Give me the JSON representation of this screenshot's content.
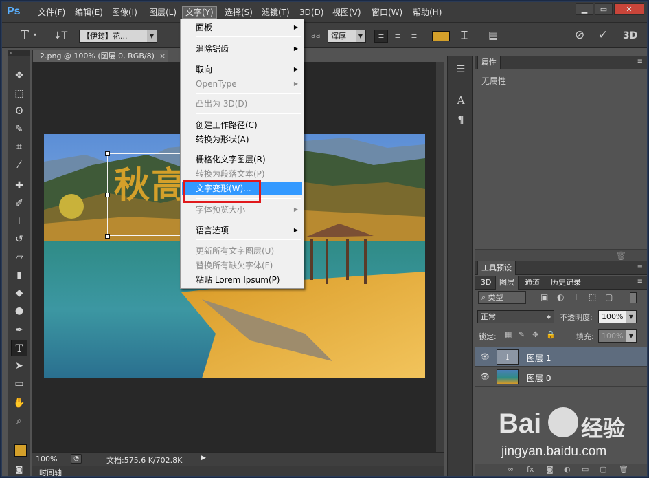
{
  "app": {
    "logo": "Ps"
  },
  "menubar": {
    "items": [
      "文件(F)",
      "编辑(E)",
      "图像(I)",
      "图层(L)",
      "文字(Y)",
      "选择(S)",
      "滤镜(T)",
      "3D(D)",
      "视图(V)",
      "窗口(W)",
      "帮助(H)"
    ],
    "active_index": 4
  },
  "window_controls": {
    "minimize": "▁",
    "restore": "▭",
    "close": "✕"
  },
  "options_bar": {
    "tool_icon": "T",
    "font_family": "【伊筠】花...",
    "antialias": "浑厚",
    "aa_label": "aa",
    "three_d": "3D"
  },
  "document_tab": {
    "title": "2.png @ 100% (图层 0, RGB/8)",
    "close": "×"
  },
  "canvas_text": {
    "value": "秋高"
  },
  "status": {
    "zoom": "100%",
    "doc_info": "文档:575.6 K/702.8K"
  },
  "timeline": {
    "label": "时间轴"
  },
  "properties": {
    "title": "属性",
    "empty_text": "无属性"
  },
  "presets": {
    "title": "工具预设"
  },
  "layers_panel": {
    "tabs": [
      "3D",
      "图层",
      "通道",
      "历史记录"
    ],
    "active_tab": 1,
    "filter_kind": "类型",
    "blend_mode": "正常",
    "opacity_label": "不透明度:",
    "opacity_value": "100%",
    "lock_label": "锁定:",
    "fill_label": "填充:",
    "fill_value": "100%",
    "layers": [
      {
        "name": "图层 1",
        "thumb": "T",
        "selected": true
      },
      {
        "name": "图层 0",
        "thumb": "",
        "selected": false
      }
    ]
  },
  "dropdown": {
    "items": [
      {
        "label": "面板",
        "submenu": true,
        "disabled": false
      },
      {
        "label": "消除锯齿",
        "submenu": true,
        "disabled": false
      },
      {
        "label": "取向",
        "submenu": true,
        "disabled": false
      },
      {
        "label": "OpenType",
        "submenu": true,
        "disabled": true
      },
      {
        "label": "凸出为 3D(D)",
        "submenu": false,
        "disabled": true
      },
      {
        "label": "创建工作路径(C)",
        "submenu": false,
        "disabled": false
      },
      {
        "label": "转换为形状(A)",
        "submenu": false,
        "disabled": false
      },
      {
        "label": "栅格化文字图层(R)",
        "submenu": false,
        "disabled": false
      },
      {
        "label": "转换为段落文本(P)",
        "submenu": false,
        "disabled": true
      },
      {
        "label": "文字变形(W)...",
        "submenu": false,
        "disabled": false,
        "highlighted": true
      },
      {
        "label": "字体预览大小",
        "submenu": true,
        "disabled": true
      },
      {
        "label": "语言选项",
        "submenu": true,
        "disabled": false
      },
      {
        "label": "更新所有文字图层(U)",
        "submenu": false,
        "disabled": true
      },
      {
        "label": "替换所有缺欠字体(F)",
        "submenu": false,
        "disabled": true
      },
      {
        "label": "粘贴 Lorem Ipsum(P)",
        "submenu": false,
        "disabled": false
      }
    ]
  },
  "watermark": {
    "brand_left": "Bai",
    "brand_right": "经验",
    "url": "jingyan.baidu.com"
  },
  "colors": {
    "accent": "#3399ff",
    "highlight_box": "#e0191c",
    "font_color_swatch": "#d4a02a",
    "foreground": "#d4a02a"
  }
}
